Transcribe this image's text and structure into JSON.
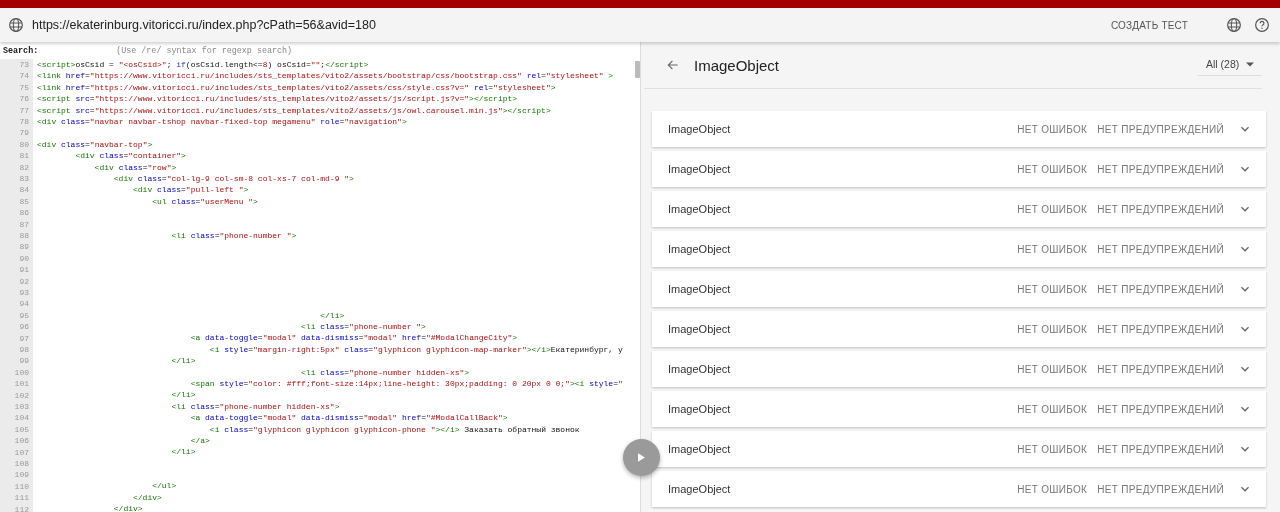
{
  "top_bar": {
    "url": "https://ekaterinburg.vitoricci.ru/index.php?cPath=56&avid=180",
    "action": "СОЗДАТЬ ТЕСТ"
  },
  "source": {
    "search_label": "Search:",
    "search_placeholder": "(Use /re/ syntax for regexp search)",
    "lines": [
      {
        "number": "73",
        "tokens": [
          {
            "kind": "tag",
            "text": "<script>"
          },
          {
            "kind": "text",
            "text": "osCsid = "
          },
          {
            "kind": "string",
            "text": "\"<osCsid>\""
          },
          {
            "kind": "text",
            "text": "; "
          },
          {
            "kind": "keyword",
            "text": "if"
          },
          {
            "kind": "text",
            "text": "(osCsid.length<="
          },
          {
            "kind": "string",
            "text": "8"
          },
          {
            "kind": "text",
            "text": ") osCsid="
          },
          {
            "kind": "string",
            "text": "\"\""
          },
          {
            "kind": "text",
            "text": ";"
          },
          {
            "kind": "tag",
            "text": "</script>"
          }
        ]
      },
      {
        "number": "74",
        "tokens": [
          {
            "kind": "tag",
            "text": "<link "
          },
          {
            "kind": "attr",
            "text": "href"
          },
          {
            "kind": "text",
            "text": "="
          },
          {
            "kind": "string",
            "text": "\"https://www.vitoricci.ru/includes/sts_templates/vito2/assets/bootstrap/css/bootstrap.css\""
          },
          {
            "kind": "attr",
            "text": " rel"
          },
          {
            "kind": "text",
            "text": "="
          },
          {
            "kind": "string",
            "text": "\"stylesheet\""
          },
          {
            "kind": "tag",
            "text": " >"
          }
        ]
      },
      {
        "number": "75",
        "tokens": [
          {
            "kind": "tag",
            "text": "<link "
          },
          {
            "kind": "attr",
            "text": "href"
          },
          {
            "kind": "text",
            "text": "="
          },
          {
            "kind": "string",
            "text": "\"https://www.vitoricci.ru/includes/sts_templates/vito2/assets/css/style.css?v=\""
          },
          {
            "kind": "attr",
            "text": " rel"
          },
          {
            "kind": "text",
            "text": "="
          },
          {
            "kind": "string",
            "text": "\"stylesheet\""
          },
          {
            "kind": "tag",
            "text": ">"
          }
        ]
      },
      {
        "number": "76",
        "tokens": [
          {
            "kind": "tag",
            "text": "<script "
          },
          {
            "kind": "attr",
            "text": "src"
          },
          {
            "kind": "text",
            "text": "="
          },
          {
            "kind": "string",
            "text": "\"https://www.vitoricci.ru/includes/sts_templates/vito2/assets/js/script.js?v=\""
          },
          {
            "kind": "tag",
            "text": "></script>"
          }
        ]
      },
      {
        "number": "77",
        "tokens": [
          {
            "kind": "tag",
            "text": "<script "
          },
          {
            "kind": "attr",
            "text": "src"
          },
          {
            "kind": "text",
            "text": "="
          },
          {
            "kind": "string",
            "text": "\"https://www.vitoricci.ru/includes/sts_templates/vito2/assets/js/owl.carousel.min.js\""
          },
          {
            "kind": "tag",
            "text": "></script>"
          }
        ]
      },
      {
        "number": "78",
        "tokens": [
          {
            "kind": "tag",
            "text": "<div "
          },
          {
            "kind": "attr",
            "text": "class"
          },
          {
            "kind": "text",
            "text": "="
          },
          {
            "kind": "string",
            "text": "\"navbar navbar-tshop navbar-fixed-top megamenu\""
          },
          {
            "kind": "attr",
            "text": " role"
          },
          {
            "kind": "text",
            "text": "="
          },
          {
            "kind": "string",
            "text": "\"navigation\""
          },
          {
            "kind": "tag",
            "text": ">"
          }
        ]
      },
      {
        "number": "79"
      },
      {
        "number": "80",
        "tokens": [
          {
            "kind": "tag",
            "text": "<div "
          },
          {
            "kind": "attr",
            "text": "class"
          },
          {
            "kind": "text",
            "text": "="
          },
          {
            "kind": "string",
            "text": "\"navbar-top\""
          },
          {
            "kind": "tag",
            "text": ">"
          }
        ]
      },
      {
        "number": "81",
        "tokens": [
          {
            "kind": "tag",
            "text": "        <div "
          },
          {
            "kind": "attr",
            "text": "class"
          },
          {
            "kind": "text",
            "text": "="
          },
          {
            "kind": "string",
            "text": "\"container\""
          },
          {
            "kind": "tag",
            "text": ">"
          }
        ]
      },
      {
        "number": "82",
        "tokens": [
          {
            "kind": "tag",
            "text": "            <div "
          },
          {
            "kind": "attr",
            "text": "class"
          },
          {
            "kind": "text",
            "text": "="
          },
          {
            "kind": "string",
            "text": "\"row\""
          },
          {
            "kind": "tag",
            "text": ">"
          }
        ]
      },
      {
        "number": "83",
        "tokens": [
          {
            "kind": "tag",
            "text": "                <div "
          },
          {
            "kind": "attr",
            "text": "class"
          },
          {
            "kind": "text",
            "text": "="
          },
          {
            "kind": "string",
            "text": "\"col-lg-9 col-sm-8 col-xs-7 col-md-9 \""
          },
          {
            "kind": "tag",
            "text": ">"
          }
        ]
      },
      {
        "number": "84",
        "tokens": [
          {
            "kind": "tag",
            "text": "                    <div "
          },
          {
            "kind": "attr",
            "text": "class"
          },
          {
            "kind": "text",
            "text": "="
          },
          {
            "kind": "string",
            "text": "\"pull-left \""
          },
          {
            "kind": "tag",
            "text": ">"
          }
        ]
      },
      {
        "number": "85",
        "tokens": [
          {
            "kind": "tag",
            "text": "                        <ul "
          },
          {
            "kind": "attr",
            "text": "class"
          },
          {
            "kind": "text",
            "text": "="
          },
          {
            "kind": "string",
            "text": "\"userMenu \""
          },
          {
            "kind": "tag",
            "text": ">"
          }
        ]
      },
      {
        "number": "86"
      },
      {
        "number": "87"
      },
      {
        "number": "88",
        "tokens": [
          {
            "kind": "tag",
            "text": "                            <li "
          },
          {
            "kind": "attr",
            "text": "class"
          },
          {
            "kind": "text",
            "text": "="
          },
          {
            "kind": "string",
            "text": "\"phone-number \""
          },
          {
            "kind": "tag",
            "text": ">"
          }
        ]
      },
      {
        "number": "89"
      },
      {
        "number": "90"
      },
      {
        "number": "91"
      },
      {
        "number": "92"
      },
      {
        "number": "93"
      },
      {
        "number": "94"
      },
      {
        "number": "95",
        "tokens": [
          {
            "kind": "tag",
            "text": "                                                           </li>"
          }
        ]
      },
      {
        "number": "96",
        "tokens": [
          {
            "kind": "tag",
            "text": "                                                       <li "
          },
          {
            "kind": "attr",
            "text": "class"
          },
          {
            "kind": "text",
            "text": "="
          },
          {
            "kind": "string",
            "text": "\"phone-number \""
          },
          {
            "kind": "tag",
            "text": ">"
          }
        ]
      },
      {
        "number": "97",
        "tokens": [
          {
            "kind": "tag",
            "text": "                                <a "
          },
          {
            "kind": "attr",
            "text": "data-toggle"
          },
          {
            "kind": "text",
            "text": "="
          },
          {
            "kind": "string",
            "text": "\"modal\""
          },
          {
            "kind": "attr",
            "text": " data-dismiss"
          },
          {
            "kind": "text",
            "text": "="
          },
          {
            "kind": "string",
            "text": "\"modal\""
          },
          {
            "kind": "attr",
            "text": " href"
          },
          {
            "kind": "text",
            "text": "="
          },
          {
            "kind": "string",
            "text": "\"#ModalChangeCity\""
          },
          {
            "kind": "tag",
            "text": ">"
          }
        ]
      },
      {
        "number": "98",
        "tokens": [
          {
            "kind": "tag",
            "text": "                                    <i "
          },
          {
            "kind": "attr",
            "text": "style"
          },
          {
            "kind": "text",
            "text": "="
          },
          {
            "kind": "string",
            "text": "\"margin-right:5px\""
          },
          {
            "kind": "attr",
            "text": " class"
          },
          {
            "kind": "text",
            "text": "="
          },
          {
            "kind": "string",
            "text": "\"glyphicon glyphicon-map-marker\""
          },
          {
            "kind": "tag",
            "text": "></i>"
          },
          {
            "kind": "text",
            "text": "Екатеринбург, у"
          }
        ]
      },
      {
        "number": "99",
        "tokens": [
          {
            "kind": "tag",
            "text": "                            </li>"
          }
        ]
      },
      {
        "number": "100",
        "tokens": [
          {
            "kind": "tag",
            "text": "                                                       <li "
          },
          {
            "kind": "attr",
            "text": "class"
          },
          {
            "kind": "text",
            "text": "="
          },
          {
            "kind": "string",
            "text": "\"phone-number hidden-xs\""
          },
          {
            "kind": "tag",
            "text": ">"
          }
        ]
      },
      {
        "number": "101",
        "tokens": [
          {
            "kind": "tag",
            "text": "                                <span "
          },
          {
            "kind": "attr",
            "text": "style"
          },
          {
            "kind": "text",
            "text": "="
          },
          {
            "kind": "string",
            "text": "\"color: #fff;font-size:14px;line-height: 30px;padding: 0 20px 0 0;\""
          },
          {
            "kind": "tag",
            "text": "><i "
          },
          {
            "kind": "attr",
            "text": "style"
          },
          {
            "kind": "text",
            "text": "="
          },
          {
            "kind": "string",
            "text": "\""
          }
        ]
      },
      {
        "number": "102",
        "tokens": [
          {
            "kind": "tag",
            "text": "                            </li>"
          }
        ]
      },
      {
        "number": "103",
        "tokens": [
          {
            "kind": "tag",
            "text": "                            <li "
          },
          {
            "kind": "attr",
            "text": "class"
          },
          {
            "kind": "text",
            "text": "="
          },
          {
            "kind": "string",
            "text": "\"phone-number hidden-xs\""
          },
          {
            "kind": "tag",
            "text": ">"
          }
        ]
      },
      {
        "number": "104",
        "tokens": [
          {
            "kind": "tag",
            "text": "                                <a "
          },
          {
            "kind": "attr",
            "text": "data-toggle"
          },
          {
            "kind": "text",
            "text": "="
          },
          {
            "kind": "string",
            "text": "\"modal\""
          },
          {
            "kind": "attr",
            "text": " data-dismiss"
          },
          {
            "kind": "text",
            "text": "="
          },
          {
            "kind": "string",
            "text": "\"modal\""
          },
          {
            "kind": "attr",
            "text": " href"
          },
          {
            "kind": "text",
            "text": "="
          },
          {
            "kind": "string",
            "text": "\"#ModalCallBack\""
          },
          {
            "kind": "tag",
            "text": ">"
          }
        ]
      },
      {
        "number": "105",
        "tokens": [
          {
            "kind": "tag",
            "text": "                                    <i "
          },
          {
            "kind": "attr",
            "text": "class"
          },
          {
            "kind": "text",
            "text": "="
          },
          {
            "kind": "string",
            "text": "\"glyphicon glyphicon glyphicon-phone \""
          },
          {
            "kind": "tag",
            "text": "></i>"
          },
          {
            "kind": "text",
            "text": " Заказать обратный звонок"
          }
        ]
      },
      {
        "number": "106",
        "tokens": [
          {
            "kind": "tag",
            "text": "                                </a>"
          }
        ]
      },
      {
        "number": "107",
        "tokens": [
          {
            "kind": "tag",
            "text": "                            </li>"
          }
        ]
      },
      {
        "number": "108"
      },
      {
        "number": "109"
      },
      {
        "number": "110",
        "tokens": [
          {
            "kind": "tag",
            "text": "                        </ul>"
          }
        ]
      },
      {
        "number": "111",
        "tokens": [
          {
            "kind": "tag",
            "text": "                    </div>"
          }
        ]
      },
      {
        "number": "112",
        "tokens": [
          {
            "kind": "tag",
            "text": "                </div>"
          }
        ]
      }
    ]
  },
  "results": {
    "title": "ImageObject",
    "filter": "All (28)",
    "items": [
      {
        "name": "ImageObject",
        "errors": "НЕТ ОШИБОК",
        "warnings": "НЕТ ПРЕДУПРЕЖДЕНИЙ"
      },
      {
        "name": "ImageObject",
        "errors": "НЕТ ОШИБОК",
        "warnings": "НЕТ ПРЕДУПРЕЖДЕНИЙ"
      },
      {
        "name": "ImageObject",
        "errors": "НЕТ ОШИБОК",
        "warnings": "НЕТ ПРЕДУПРЕЖДЕНИЙ"
      },
      {
        "name": "ImageObject",
        "errors": "НЕТ ОШИБОК",
        "warnings": "НЕТ ПРЕДУПРЕЖДЕНИЙ"
      },
      {
        "name": "ImageObject",
        "errors": "НЕТ ОШИБОК",
        "warnings": "НЕТ ПРЕДУПРЕЖДЕНИЙ"
      },
      {
        "name": "ImageObject",
        "errors": "НЕТ ОШИБОК",
        "warnings": "НЕТ ПРЕДУПРЕЖДЕНИЙ"
      },
      {
        "name": "ImageObject",
        "errors": "НЕТ ОШИБОК",
        "warnings": "НЕТ ПРЕДУПРЕЖДЕНИЙ"
      },
      {
        "name": "ImageObject",
        "errors": "НЕТ ОШИБОК",
        "warnings": "НЕТ ПРЕДУПРЕЖДЕНИЙ"
      },
      {
        "name": "ImageObject",
        "errors": "НЕТ ОШИБОК",
        "warnings": "НЕТ ПРЕДУПРЕЖДЕНИЙ"
      },
      {
        "name": "ImageObject",
        "errors": "НЕТ ОШИБОК",
        "warnings": "НЕТ ПРЕДУПРЕЖДЕНИЙ"
      }
    ]
  }
}
